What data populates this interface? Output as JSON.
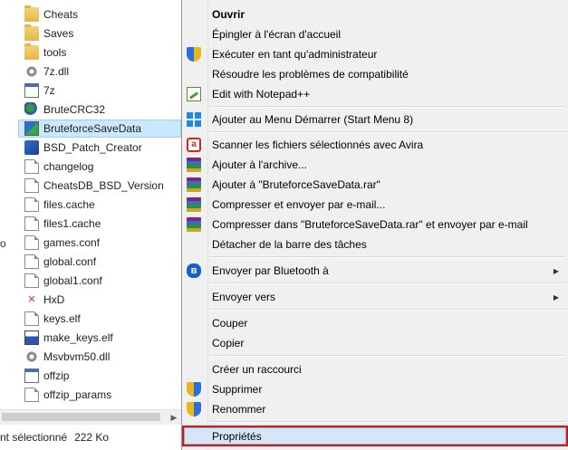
{
  "explorer": {
    "files": [
      {
        "name": "Cheats",
        "icon": "folder-icon",
        "selected": false
      },
      {
        "name": "Saves",
        "icon": "folder-icon",
        "selected": false
      },
      {
        "name": "tools",
        "icon": "folder-icon",
        "selected": false
      },
      {
        "name": "7z.dll",
        "icon": "dll-file-icon",
        "selected": false
      },
      {
        "name": "7z",
        "icon": "exe-file-icon",
        "selected": false
      },
      {
        "name": "BruteCRC32",
        "icon": "brutecrc-app-icon",
        "selected": false
      },
      {
        "name": "BruteforceSaveData",
        "icon": "bruteforce-app-icon",
        "selected": true
      },
      {
        "name": "BSD_Patch_Creator",
        "icon": "bsd-app-icon",
        "selected": false
      },
      {
        "name": "changelog",
        "icon": "text-file-icon",
        "selected": false
      },
      {
        "name": "CheatsDB_BSD_Version",
        "icon": "text-file-icon",
        "selected": false
      },
      {
        "name": "files.cache",
        "icon": "file-icon",
        "selected": false
      },
      {
        "name": "files1.cache",
        "icon": "file-icon",
        "selected": false
      },
      {
        "name": "games.conf",
        "icon": "file-icon",
        "selected": false
      },
      {
        "name": "global.conf",
        "icon": "file-icon",
        "selected": false
      },
      {
        "name": "global1.conf",
        "icon": "file-icon",
        "selected": false
      },
      {
        "name": "HxD",
        "icon": "hxd-app-icon",
        "selected": false
      },
      {
        "name": "keys.elf",
        "icon": "file-icon",
        "selected": false
      },
      {
        "name": "make_keys.elf",
        "icon": "elf-app-icon",
        "selected": false
      },
      {
        "name": "Msvbvm50.dll",
        "icon": "dll-file-icon",
        "selected": false
      },
      {
        "name": "offzip",
        "icon": "exe-file-icon",
        "selected": false
      },
      {
        "name": "offzip_params",
        "icon": "text-file-icon",
        "selected": false
      }
    ],
    "left_edge_fragment": "o",
    "status": {
      "selection": "nt sélectionné",
      "size": "222 Ko"
    }
  },
  "context_menu": {
    "items": [
      {
        "label": "Ouvrir",
        "icon": "",
        "bold": true
      },
      {
        "label": "Épingler à l'écran d'accueil",
        "icon": ""
      },
      {
        "label": "Exécuter en tant qu'administrateur",
        "icon": "uac-shield-icon"
      },
      {
        "label": "Résoudre les problèmes de compatibilité",
        "icon": ""
      },
      {
        "label": "Edit with Notepad++",
        "icon": "notepad-plus-plus-icon"
      },
      {
        "label": "Ajouter au Menu Démarrer (Start Menu 8)",
        "icon": "windows-logo-icon"
      },
      {
        "label": "Scanner les fichiers sélectionnés avec Avira",
        "icon": "avira-icon"
      },
      {
        "label": "Ajouter à l'archive...",
        "icon": "winrar-icon"
      },
      {
        "label": "Ajouter à \"BruteforceSaveData.rar\"",
        "icon": "winrar-icon"
      },
      {
        "label": "Compresser et envoyer par e-mail...",
        "icon": "winrar-icon"
      },
      {
        "label": "Compresser dans \"BruteforceSaveData.rar\" et envoyer par e-mail",
        "icon": "winrar-icon"
      },
      {
        "label": "Détacher de la barre des tâches",
        "icon": ""
      },
      {
        "label": "Envoyer par Bluetooth à",
        "icon": "bluetooth-icon",
        "submenu": true
      },
      {
        "label": "Envoyer vers",
        "icon": "",
        "submenu": true
      },
      {
        "label": "Couper",
        "icon": ""
      },
      {
        "label": "Copier",
        "icon": ""
      },
      {
        "label": "Créer un raccourci",
        "icon": ""
      },
      {
        "label": "Supprimer",
        "icon": "uac-shield-icon"
      },
      {
        "label": "Renommer",
        "icon": "uac-shield-icon"
      },
      {
        "label": "Propriétés",
        "icon": "",
        "highlighted": true
      }
    ],
    "submenu_arrow": "▶"
  },
  "colors": {
    "selection_bg": "#cce8ff",
    "menu_bg": "#f0f0f0",
    "highlight_border": "#e01010"
  }
}
